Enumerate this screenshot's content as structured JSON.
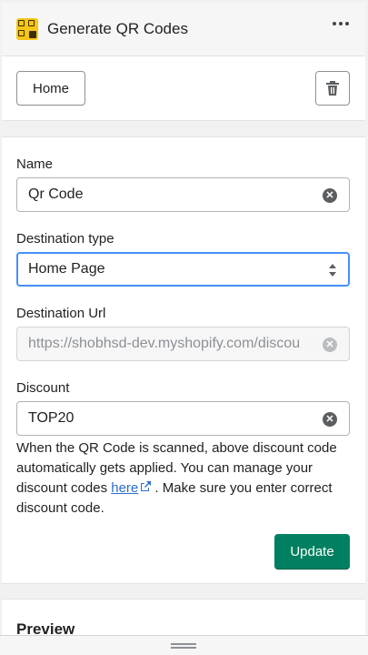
{
  "header": {
    "title": "Generate QR Codes",
    "app_icon": "qr-app-icon",
    "menu_icon": "more-horizontal-icon"
  },
  "toolbar": {
    "home_label": "Home",
    "delete_icon": "trash-icon"
  },
  "form": {
    "name": {
      "label": "Name",
      "value": "Qr Code"
    },
    "destination_type": {
      "label": "Destination type",
      "value": "Home Page"
    },
    "destination_url": {
      "label": "Destination Url",
      "value": "https://shobhsd-dev.myshopify.com/discou"
    },
    "discount": {
      "label": "Discount",
      "value": "TOP20"
    },
    "help": {
      "text_before": "When the QR Code is scanned, above discount code automatically gets applied. You can manage your discount codes ",
      "link": "here",
      "text_after": " . Make sure you enter correct discount code."
    },
    "update_label": "Update"
  },
  "preview": {
    "title": "Preview"
  },
  "colors": {
    "primary": "#008060",
    "link": "#2c6ecb",
    "focus": "#458fff",
    "app_icon_bg": "#f5c518"
  }
}
